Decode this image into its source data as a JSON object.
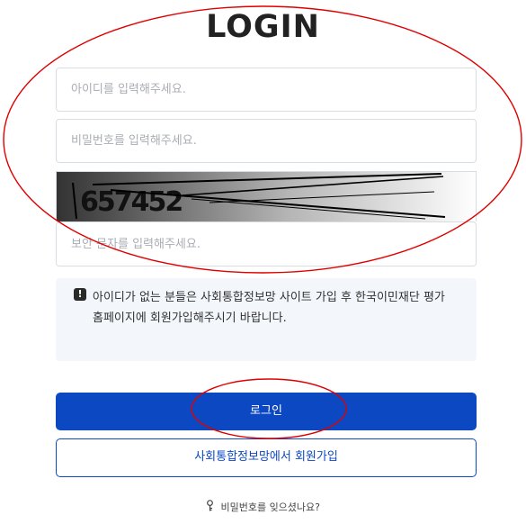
{
  "page": {
    "title": "LOGIN"
  },
  "form": {
    "id_placeholder": "아이디를 입력해주세요.",
    "password_placeholder": "비밀번호를 입력해주세요.",
    "captcha_code": "657452",
    "captcha_placeholder": "보안 문자를 입력해주세요."
  },
  "notice": {
    "icon": "exclamation-icon",
    "text": "아이디가 없는 분들은 사회통합정보망 사이트 가입 후 한국이민재단 평가 홈페이지에 회원가입해주시기 바랍니다."
  },
  "buttons": {
    "login_label": "로그인",
    "join_label": "사회통합정보망에서 회원가입"
  },
  "footer": {
    "forgot_icon": "key-icon",
    "forgot_label": "비밀번호를 잊으셨나요?"
  },
  "colors": {
    "primary": "#0c48c2",
    "annotation_red": "#e00000",
    "notice_bg": "#f3f6fa",
    "border": "#d8dde3"
  }
}
